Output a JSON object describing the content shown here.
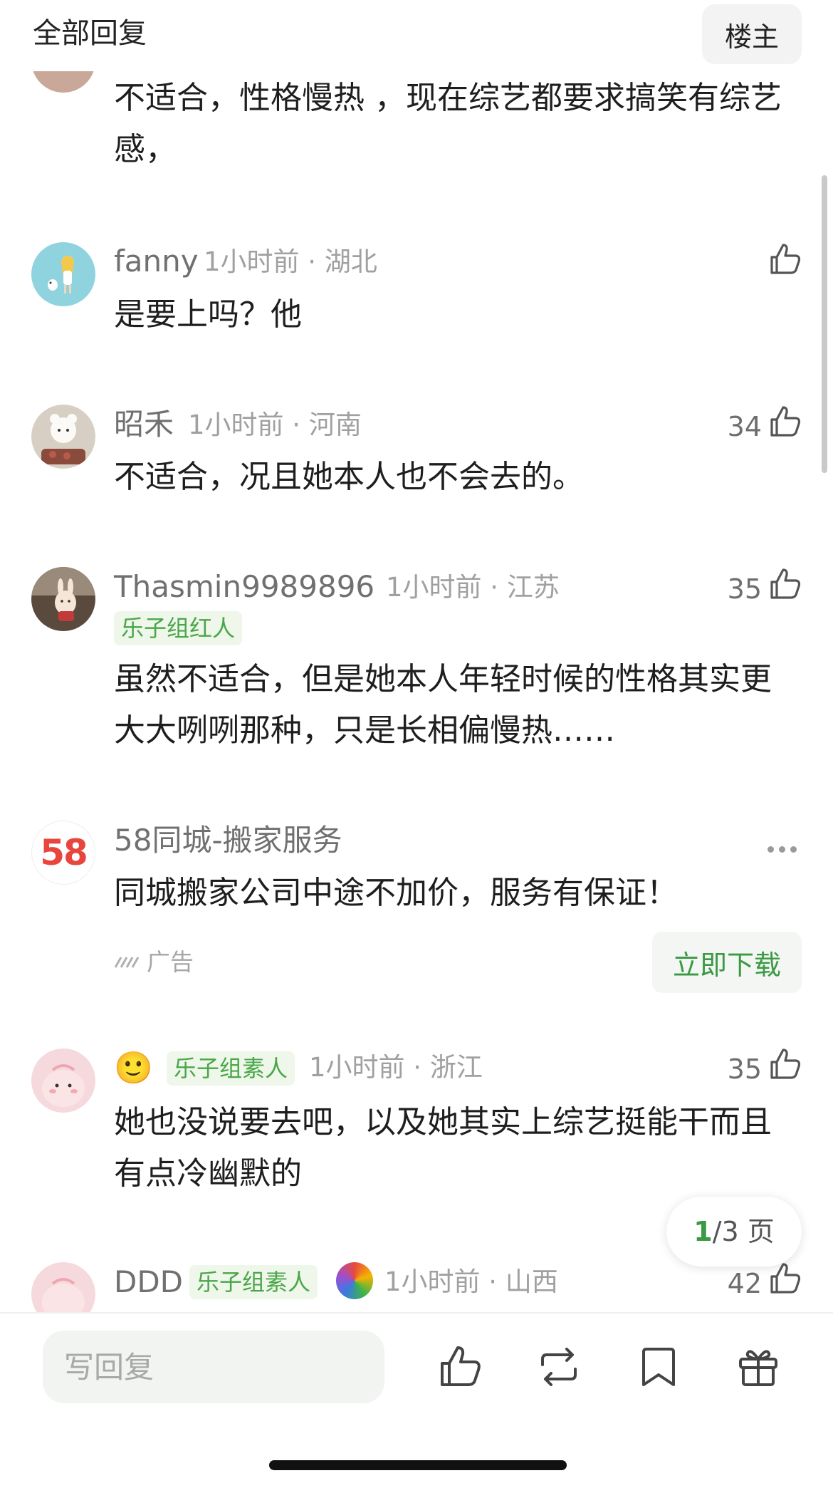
{
  "header": {
    "title": "全部回复",
    "op_button": "楼主"
  },
  "comments": [
    {
      "text": "不适合，性格慢热 ，现在综艺都要求搞笑有综艺感，"
    },
    {
      "username": "fanny",
      "meta": "1小时前 · 湖北",
      "text": "是要上吗？他"
    },
    {
      "username": "昭禾",
      "meta": "1小时前 · 河南",
      "likes": "34",
      "text": "不适合，况且她本人也不会去的。"
    },
    {
      "username": "Thasmin9989896",
      "meta": "1小时前 · 江苏",
      "likes": "35",
      "badge": "乐子组红人",
      "text": "虽然不适合，但是她本人年轻时候的性格其实更大大咧咧那种，只是长相偏慢热……"
    },
    {
      "emoji": "🙂",
      "badge": "乐子组素人",
      "meta": "1小时前 · 浙江",
      "likes": "35",
      "text": "她也没说要去吧，以及她其实上综艺挺能干而且有点冷幽默的"
    },
    {
      "username": "DDD",
      "badge": "乐子组素人",
      "meta": "1小时前 · 山西",
      "likes": "42"
    }
  ],
  "ad": {
    "name": "58同城-搬家服务",
    "logo_text": "58",
    "text": "同城搬家公司中途不加价，服务有保证！",
    "label": "广告",
    "button": "立即下载"
  },
  "pager": {
    "current": "1",
    "rest": "/3 页"
  },
  "bottom_bar": {
    "reply_placeholder": "写回复"
  },
  "colors": {
    "accent_green": "#3a9a44",
    "badge_bg": "#eef7e9",
    "badge_text": "#4aa64a"
  }
}
